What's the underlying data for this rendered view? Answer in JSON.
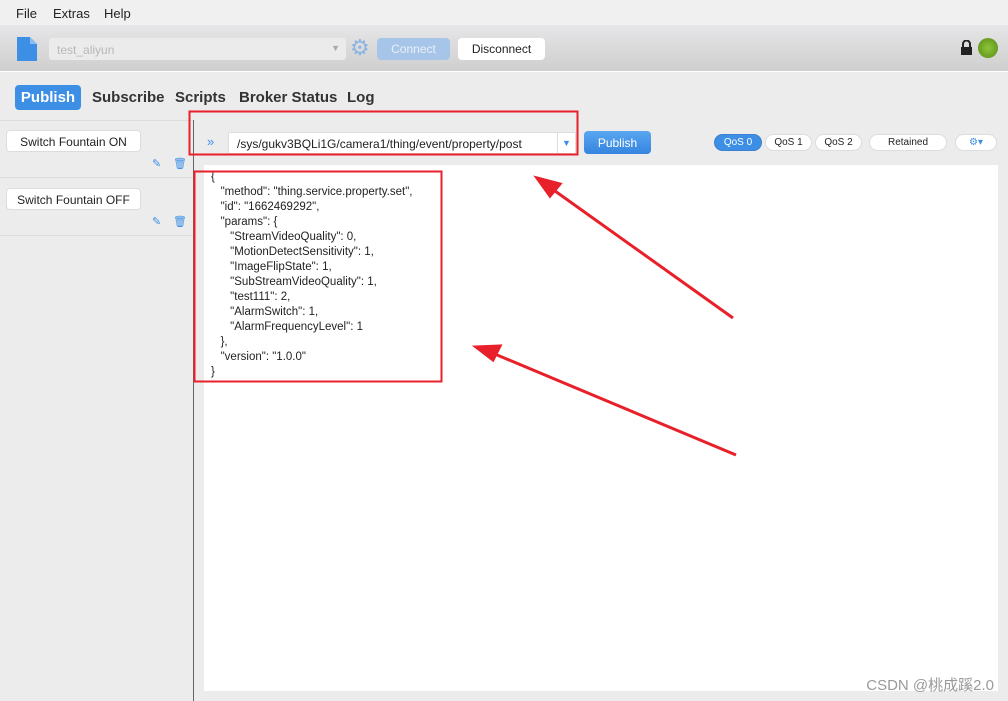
{
  "menu": [
    "File",
    "Extras",
    "Help"
  ],
  "toolbar": {
    "profile": "test_aliyun",
    "connect": "Connect",
    "disconnect": "Disconnect",
    "status_color": "#6a9e1a"
  },
  "tabs": [
    "Publish",
    "Subscribe",
    "Scripts",
    "Broker Status",
    "Log"
  ],
  "active_tab": "Publish",
  "sidebar": {
    "scripts": [
      {
        "label": "Switch Fountain ON"
      },
      {
        "label": "Switch Fountain OFF"
      }
    ]
  },
  "publish": {
    "topic": "/sys/gukv3BQLi1G/camera1/thing/event/property/post",
    "button": "Publish",
    "qos": [
      "QoS 0",
      "QoS 1",
      "QoS 2"
    ],
    "selected_qos": "QoS 0",
    "retained": "Retained"
  },
  "payload": "{\n   \"method\": \"thing.service.property.set\",\n   \"id\": \"1662469292\",\n   \"params\": {\n      \"StreamVideoQuality\": 0,\n      \"MotionDetectSensitivity\": 1,\n      \"ImageFlipState\": 1,\n      \"SubStreamVideoQuality\": 1,\n      \"test111\": 2,\n      \"AlarmSwitch\": 1,\n      \"AlarmFrequencyLevel\": 1\n   },\n   \"version\": \"1.0.0\"\n}",
  "accent": "#3d8fe6",
  "watermark": "CSDN @桃成蹊2.0"
}
